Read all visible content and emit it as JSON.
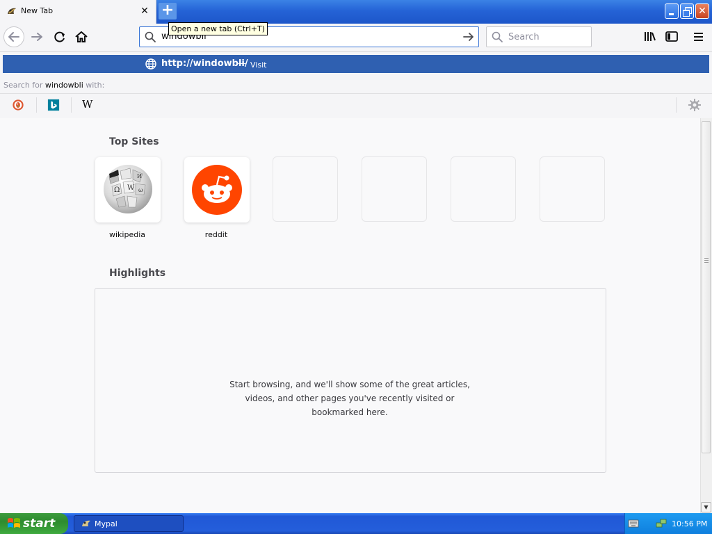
{
  "browser": {
    "tab": {
      "title": "New Tab"
    },
    "newtab_tooltip": "Open a new tab (Ctrl+T)",
    "urlbar": {
      "value": "windowbli"
    },
    "searchbar": {
      "placeholder": "Search"
    }
  },
  "autocomplete": {
    "heuristic": {
      "url": "http://windowbli/",
      "separator": "—",
      "action": "Visit"
    },
    "search_for_prefix": "Search for ",
    "search_term": "windowbli",
    "search_for_suffix": " with:",
    "engines": [
      {
        "name": "DuckDuckGo",
        "icon": "duckduckgo-icon"
      },
      {
        "name": "Bing",
        "icon": "bing-icon"
      },
      {
        "name": "Wikipedia",
        "icon": "wikipedia-icon",
        "glyph": "W"
      }
    ]
  },
  "newtab": {
    "top_sites_title": "Top Sites",
    "top_sites": [
      {
        "label": "wikipedia",
        "icon": "wikipedia-globe-icon"
      },
      {
        "label": "reddit",
        "icon": "reddit-icon"
      },
      {
        "label": ""
      },
      {
        "label": ""
      },
      {
        "label": ""
      },
      {
        "label": ""
      }
    ],
    "highlights_title": "Highlights",
    "highlights_empty_message": "Start browsing, and we'll show some of the great articles, videos, and other pages you've recently visited or bookmarked here."
  },
  "taskbar": {
    "start_label": "start",
    "items": [
      {
        "label": "Mypal"
      }
    ],
    "clock": "10:56 PM"
  },
  "colors": {
    "titlebar": "#2563d6",
    "selected_row": "#2f60b1",
    "reddit_orange": "#ff4500",
    "start_green": "#3c9b3c"
  }
}
